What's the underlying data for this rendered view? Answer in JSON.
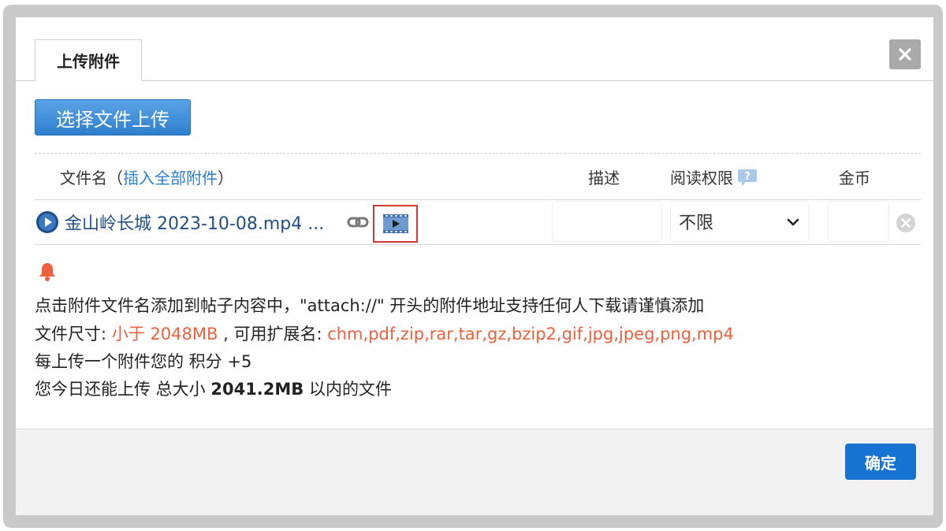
{
  "dialog": {
    "tab_label": "上传附件",
    "upload_button_label": "选择文件上传",
    "ok_button_label": "确定"
  },
  "table_header": {
    "filename_label": "文件名（",
    "insert_all_link": "插入全部附件",
    "filename_label_end": "）",
    "description_label": "描述",
    "permission_label": "阅读权限",
    "coins_label": "金币"
  },
  "attachment": {
    "filename": "金山岭长城 2023-10-08.mp4 ...",
    "description_value": "",
    "permission_selected": "不限",
    "coins_value": ""
  },
  "info": {
    "line1": "点击附件文件名添加到帖子内容中，\"attach://\" 开头的附件地址支持任何人下载请谨慎添加",
    "size_prefix": "文件尺寸: ",
    "size_limit": "小于 2048MB",
    "ext_prefix": " , 可用扩展名: ",
    "extensions": "chm,pdf,zip,rar,tar,gz,bzip2,gif,jpg,jpeg,png,mp4",
    "points_prefix": "每上传一个附件您的 积分 ",
    "points_value": "+5",
    "remaining_prefix": "您今日还能上传 总大小 ",
    "remaining_size": "2041.2MB",
    "remaining_suffix": " 以内的文件"
  },
  "colors": {
    "accent_blue": "#1673d1",
    "warning_orange": "#f0603c",
    "highlight_red": "#d23838"
  },
  "icons": {
    "close": "close-icon",
    "play": "play-circle-icon",
    "link": "chain-link-icon",
    "video": "video-file-icon",
    "help": "help-bubble-icon",
    "remove": "remove-circle-icon",
    "bell": "bell-icon"
  }
}
